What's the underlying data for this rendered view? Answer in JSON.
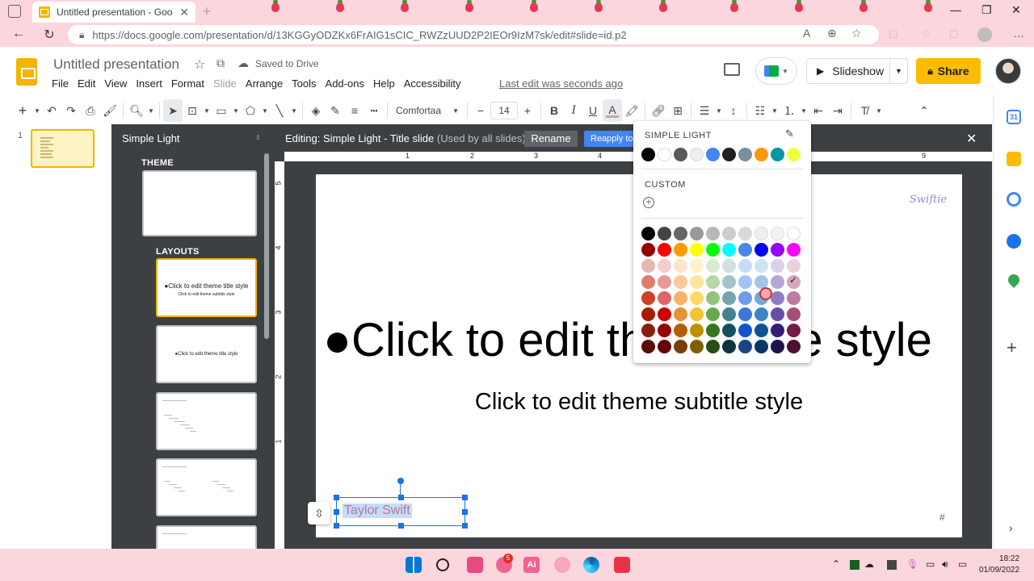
{
  "browser": {
    "tab_title": "Untitled presentation - Google S",
    "url": "https://docs.google.com/presentation/d/13KGGyODZKx6FrAIG1sCIC_RWZzUUD2P2IEOr9IzM7sk/edit#slide=id.p2"
  },
  "header": {
    "doc_title": "Untitled presentation",
    "saved_status": "Saved to Drive",
    "last_edit": "Last edit was seconds ago",
    "slideshow_label": "Slideshow",
    "share_label": "Share"
  },
  "menu": [
    "File",
    "Edit",
    "View",
    "Insert",
    "Format",
    "Slide",
    "Arrange",
    "Tools",
    "Add-ons",
    "Help",
    "Accessibility"
  ],
  "toolbar": {
    "font_name": "Comfortaa",
    "font_size": "14"
  },
  "filmstrip": {
    "slide_number": "1"
  },
  "master": {
    "title": "Simple Light",
    "theme_label": "THEME",
    "layouts_label": "LAYOUTS",
    "layout1_text": "●Click to edit theme title style",
    "layout1_sub": "Click to edit theme subtitle style",
    "layout2_text": "●Click to edit theme title style"
  },
  "editbar": {
    "title": "Editing: Simple Light - Title slide",
    "subtitle": "(Used by all slides)",
    "rename_label": "Rename",
    "reapply_label": "Reapply to"
  },
  "ruler": {
    "h": [
      "1",
      "2",
      "3",
      "4",
      "9"
    ],
    "v": [
      "5",
      "4",
      "3",
      "2",
      "1"
    ]
  },
  "slide": {
    "brand": "Swiftie",
    "title": "●Click to edit theme title style",
    "subtitle": "Click to edit theme subtitle style",
    "selected_text": "Taylor Swift",
    "slide_number_placeholder": "#"
  },
  "color_picker": {
    "theme_label": "SIMPLE LIGHT",
    "custom_label": "CUSTOM",
    "theme_colors": [
      "#000000",
      "#ffffff",
      "#595959",
      "#eeeeee",
      "#4285f4",
      "#212121",
      "#78909c",
      "#ff9800",
      "#0097a7",
      "#eeff41"
    ],
    "palette": [
      [
        "#000000",
        "#434343",
        "#666666",
        "#999999",
        "#b7b7b7",
        "#cccccc",
        "#d9d9d9",
        "#efefef",
        "#f3f3f3",
        "#ffffff"
      ],
      [
        "#980000",
        "#ff0000",
        "#ff9900",
        "#ffff00",
        "#00ff00",
        "#00ffff",
        "#4a86e8",
        "#0000ff",
        "#9900ff",
        "#ff00ff"
      ],
      [
        "#e6b8af",
        "#f4cccc",
        "#fce5cd",
        "#fff2cc",
        "#d9ead3",
        "#d0e0e3",
        "#c9daf8",
        "#cfe2f3",
        "#d9d2e9",
        "#ead1dc"
      ],
      [
        "#dd7e6b",
        "#ea9999",
        "#f9cb9c",
        "#ffe599",
        "#b6d7a8",
        "#a2c4c9",
        "#a4c2f4",
        "#9fc5e8",
        "#b4a7d6",
        "#d5a6bd"
      ],
      [
        "#cc4125",
        "#e06666",
        "#f6b26b",
        "#ffd966",
        "#93c47d",
        "#76a5af",
        "#6d9eeb",
        "#6fa8dc",
        "#8e7cc3",
        "#c27ba0"
      ],
      [
        "#a61c00",
        "#cc0000",
        "#e69138",
        "#f1c232",
        "#6aa84f",
        "#45818e",
        "#3c78d8",
        "#3d85c6",
        "#674ea7",
        "#a64d79"
      ],
      [
        "#85200c",
        "#990000",
        "#b45f06",
        "#bf9000",
        "#38761d",
        "#134f5c",
        "#1155cc",
        "#0b5394",
        "#351c75",
        "#741b47"
      ],
      [
        "#5b0f00",
        "#660000",
        "#783f04",
        "#7f6000",
        "#274e13",
        "#0c343d",
        "#1c4587",
        "#073763",
        "#20124d",
        "#4c1130"
      ]
    ],
    "selected": "#d5a6bd"
  },
  "taskbar": {
    "badge": "5",
    "time": "18:22",
    "date": "01/09/2022"
  }
}
